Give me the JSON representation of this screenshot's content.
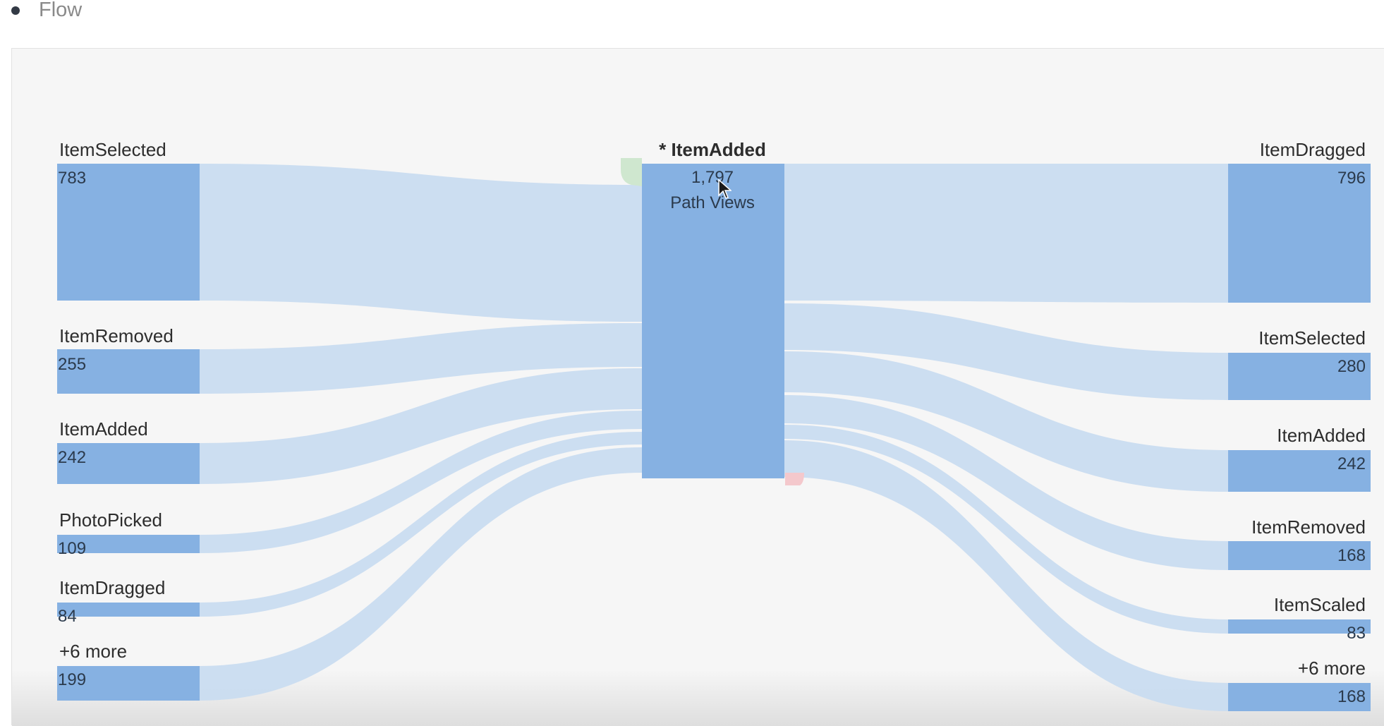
{
  "header": {
    "title": "Flow"
  },
  "flow": {
    "focus": {
      "label": "* ItemAdded",
      "value": "1,797",
      "unit": "Path Views"
    },
    "previous": [
      {
        "label": "ItemSelected",
        "value": "783"
      },
      {
        "label": "ItemRemoved",
        "value": "255"
      },
      {
        "label": "ItemAdded",
        "value": "242"
      },
      {
        "label": "PhotoPicked",
        "value": "109"
      },
      {
        "label": "ItemDragged",
        "value": "84"
      },
      {
        "label": "+6 more",
        "value": "199"
      }
    ],
    "next": [
      {
        "label": "ItemDragged",
        "value": "796"
      },
      {
        "label": "ItemSelected",
        "value": "280"
      },
      {
        "label": "ItemAdded",
        "value": "242"
      },
      {
        "label": "ItemRemoved",
        "value": "168"
      },
      {
        "label": "ItemScaled",
        "value": "83"
      },
      {
        "label": "+6 more",
        "value": "168"
      }
    ],
    "colors": {
      "node": "#86b1e2",
      "link": "#c9dcf0",
      "entry_marker": "#cfe7cf",
      "exit_marker": "#f4c8cc"
    }
  }
}
